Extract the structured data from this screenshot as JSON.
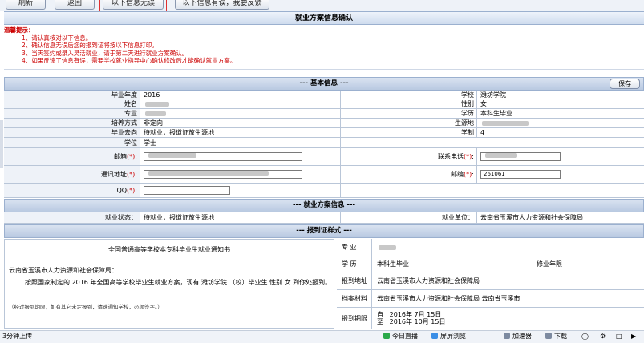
{
  "toolbar": {
    "refresh_label": "刷新",
    "back_label": "返回",
    "confirm_label": "以下信息无误",
    "feedback_label": "以下信息有误，我要反馈"
  },
  "page_title": "就业方案信息确认",
  "tips": {
    "heading": "温馨提示：",
    "items": [
      "1、请认真核对以下信息。",
      "2、确认信息无误后您的报到证将按以下信息打印。",
      "3、当天签约或录入灵活就业，请于第二天进行就业方案确认。",
      "4、如果反馈了信息有误，需要学校就业指导中心确认修改后才能确认就业方案。"
    ]
  },
  "basic": {
    "section_title": "--- 基本信息 ---",
    "save_label": "保存",
    "grad_year_label": "毕业年度",
    "grad_year": "2016",
    "school_label": "学校",
    "school": "潍坊学院",
    "name_label": "姓名",
    "gender_label": "性别",
    "gender": "女",
    "major_label": "专业",
    "education_label": "学历",
    "education": "本科生毕业",
    "training_label": "培养方式",
    "training": "非定向",
    "origin_label": "生源地",
    "destination_label": "毕业去向",
    "destination": "待就业，报道证放生源地",
    "duration_label": "学制",
    "duration": "4",
    "degree_label": "学位",
    "degree": "学士",
    "email_label": "邮箱",
    "phone_label": "联系电话",
    "address_label": "通讯地址",
    "postcode_label": "邮编",
    "postcode": "261061",
    "qq_label": "QQ",
    "required_mark": "(*)"
  },
  "plan": {
    "section_title": "--- 就业方案信息 ---",
    "status_label": "就业状态：",
    "status": "待就业，报道证放生源地",
    "unit_label": "就业单位：",
    "unit": "云南省玉溪市人力资源和社会保障局"
  },
  "report": {
    "section_title": "--- 报到证样式 ---",
    "notice_title": "全国普通高等学校本专科毕业生就业通知书",
    "addressee": "云南省玉溪市人力资源和社会保障局：",
    "body": "按照国家制定的  2016  年全国高等学校毕业生就业方案，现有  潍坊学院  （校）毕业生        性别  女  到你处报到。",
    "footnote": "（经过报到期限，如有其它未定报到，请速通知学校，必须签字。）",
    "major_label": "专  业",
    "edu_label": "学  历",
    "edu_value": "本科生毕业",
    "years_label": "修业年限",
    "report_addr_label": "报到地址",
    "report_addr": "云南省玉溪市人力资源和社会保障局",
    "archive_label": "档案材料",
    "archive": "云南省玉溪市人力资源和社会保障局 云南省玉溪市",
    "period_label": "报到期限",
    "period_from_label": "自",
    "period_from": "2016年  7月  15日",
    "period_to_label": "至",
    "period_to": "2016年  10月  15日"
  },
  "statusbar": {
    "left": "3分钟上传",
    "live": "今日直播",
    "screen": "屏屏浏览",
    "accel": "加速器",
    "download": "下载"
  },
  "colors": {
    "accent_red": "#cc0000",
    "section_blue": "#b9c9e1"
  }
}
